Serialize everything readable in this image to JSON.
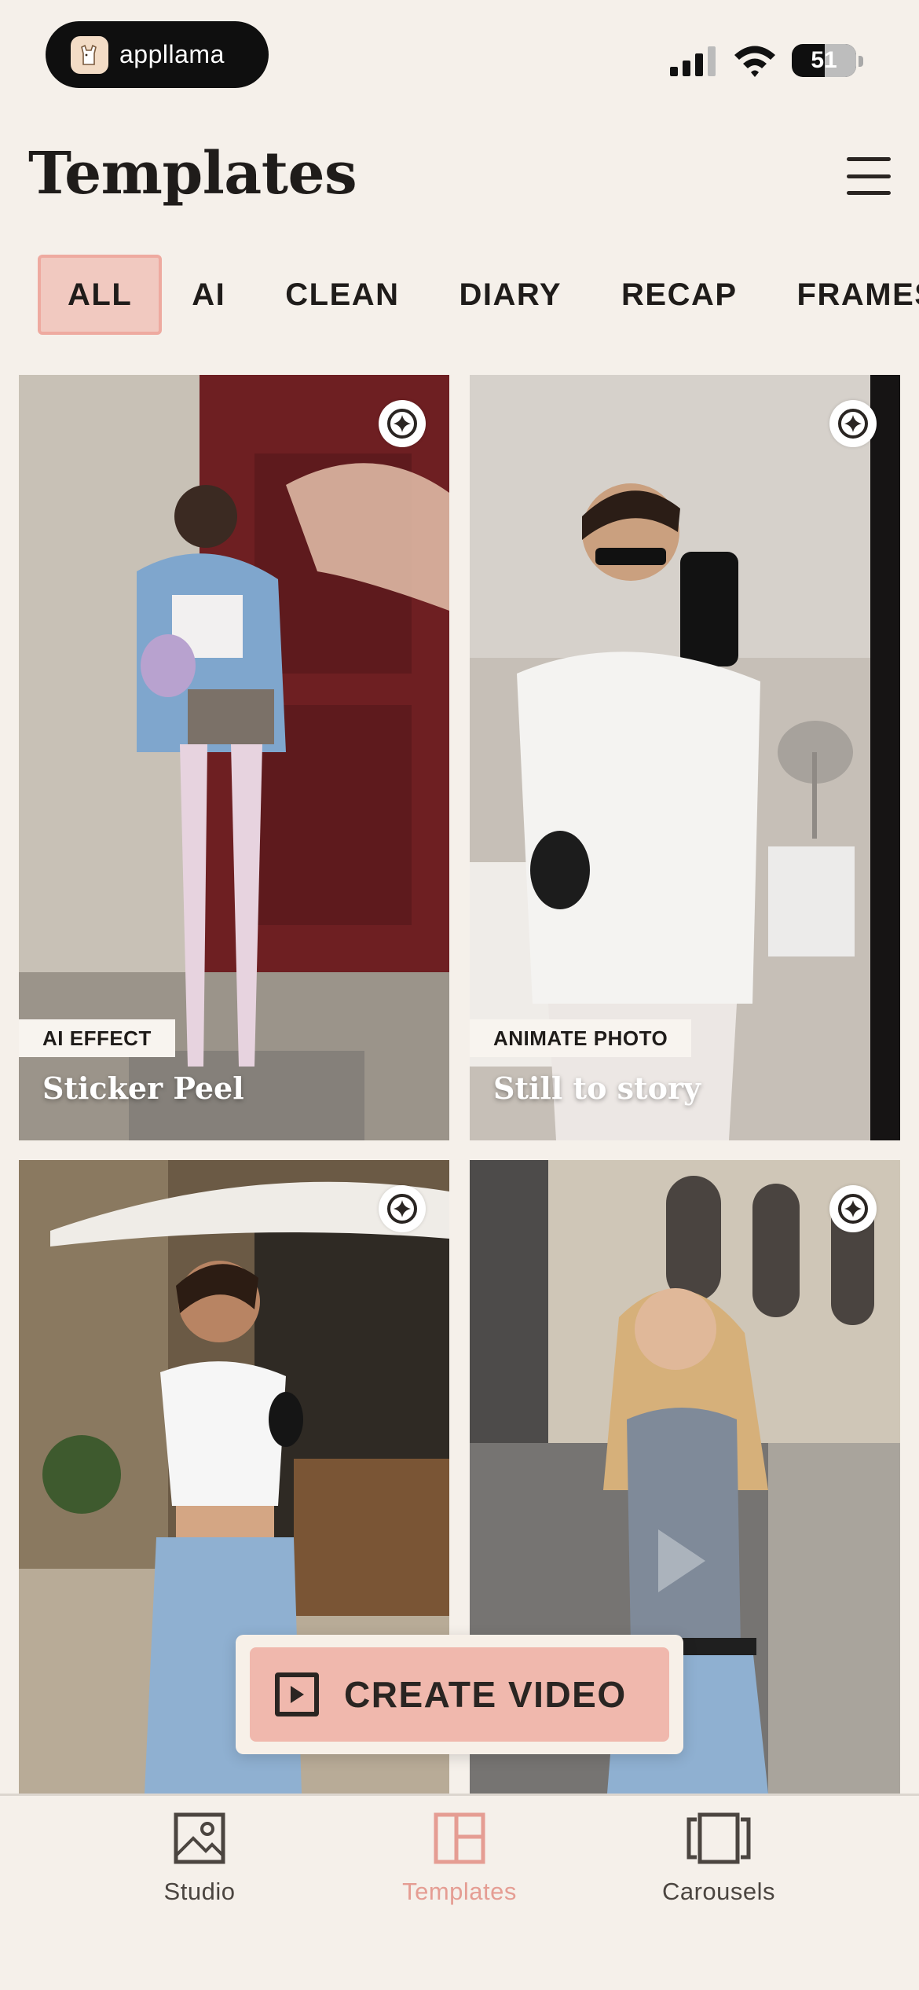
{
  "status_bar": {
    "app_name": "appllama",
    "battery": "51",
    "battery_level": 0.51
  },
  "header": {
    "title": "Templates"
  },
  "tabs": [
    {
      "label": "ALL",
      "active": true
    },
    {
      "label": "AI",
      "active": false
    },
    {
      "label": "CLEAN",
      "active": false
    },
    {
      "label": "DIARY",
      "active": false
    },
    {
      "label": "RECAP",
      "active": false
    },
    {
      "label": "FRAMES",
      "active": false
    }
  ],
  "cards": [
    {
      "tag": "AI EFFECT",
      "title": "Sticker Peel",
      "icon": "sparkle-icon"
    },
    {
      "tag": "ANIMATE PHOTO",
      "title": "Still to story",
      "icon": "sparkle-icon"
    },
    {
      "icon": "sparkle-icon"
    },
    {
      "icon": "sparkle-icon"
    }
  ],
  "create_button": {
    "label": "CREATE VIDEO",
    "icon": "play-icon"
  },
  "bottom_nav": [
    {
      "label": "Studio",
      "icon": "image-icon"
    },
    {
      "label": "Templates",
      "icon": "templates-icon",
      "active": true
    },
    {
      "label": "Carousels",
      "icon": "carousel-icon"
    }
  ],
  "colors": {
    "background": "#f5f0ea",
    "accent": "#f0b8ad",
    "accent_text": "#e59d93",
    "text": "#1f1c1a"
  }
}
